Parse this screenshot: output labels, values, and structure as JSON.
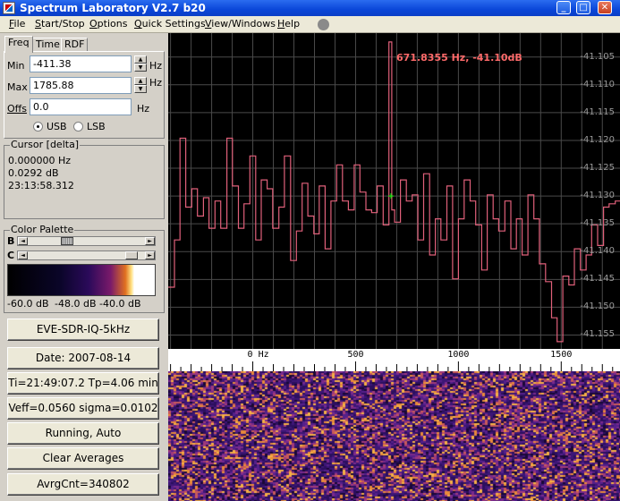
{
  "window": {
    "title": "Spectrum Laboratory V2.7 b20"
  },
  "menu": [
    "File",
    "Start/Stop",
    "Options",
    "Quick Settings",
    "View/Windows",
    "Help"
  ],
  "tabs": [
    "Freq",
    "Time",
    "RDF"
  ],
  "freq": {
    "min_label": "Min",
    "min_value": "-411.38",
    "max_label": "Max",
    "max_value": "1785.88",
    "offs_label": "Offs",
    "offs_value": "0.0",
    "unit": "Hz",
    "usb_label": "USB",
    "lsb_label": "LSB",
    "mode_selected": "USB"
  },
  "cursor": {
    "title": "Cursor [delta]",
    "freq": "0.000000 Hz",
    "db": "0.0292 dB",
    "time": "23:13:58.312"
  },
  "palette": {
    "title": "Color Palette",
    "b_label": "B",
    "c_label": "C",
    "b_level": 0.32,
    "c_level": 0.93,
    "scale_labels": [
      "-60.0 dB",
      "-48.0 dB",
      "-40.0 dB"
    ]
  },
  "buttons": {
    "source": "EVE-SDR-IQ-5kHz",
    "date": "Date: 2007-08-14",
    "time_info": "Ti=21:49:07.2  Tp=4.06 min",
    "veff": "Veff=0.0560 sigma=0.0102",
    "status": "Running, Auto",
    "clear": "Clear Averages",
    "avrg": "AvrgCnt=340802"
  },
  "spectrum": {
    "cursor_readout": "671.8355 Hz, -41.10dB",
    "colors": {
      "trace": "#e0607a",
      "grid": "#4a4a4a",
      "marker": "#00ff00",
      "readout": "#ff6a6a"
    }
  },
  "chart_data": {
    "type": "line",
    "xlabel": "",
    "ylabel": "",
    "xlim": [
      -411.38,
      1785.88
    ],
    "ylim": [
      -41.1575,
      -41.1007
    ],
    "x_ticks": [
      0,
      500,
      1000,
      1500
    ],
    "x_tick_labels": [
      "0 Hz",
      "500",
      "1000",
      "1500"
    ],
    "y_ticks": [
      -41.105,
      -41.11,
      -41.115,
      -41.12,
      -41.125,
      -41.13,
      -41.135,
      -41.14,
      -41.145,
      -41.15,
      -41.155
    ],
    "y_tick_labels": [
      "-41.105",
      "-41.110",
      "-41.115",
      "-41.120",
      "-41.125",
      "-41.130",
      "-41.135",
      "-41.140",
      "-41.145",
      "-41.150",
      "-41.155"
    ],
    "grid": true,
    "series": [
      {
        "values": [
          [
            -411,
            -41.1464
          ],
          [
            -381,
            -41.1464
          ],
          [
            -381,
            -41.1379
          ],
          [
            -354,
            -41.1379
          ],
          [
            -354,
            -41.1196
          ],
          [
            -326,
            -41.1196
          ],
          [
            -326,
            -41.132
          ],
          [
            -297,
            -41.132
          ],
          [
            -297,
            -41.1287
          ],
          [
            -269,
            -41.1287
          ],
          [
            -269,
            -41.1336
          ],
          [
            -240,
            -41.1336
          ],
          [
            -240,
            -41.1303
          ],
          [
            -213,
            -41.1303
          ],
          [
            -213,
            -41.1358
          ],
          [
            -184,
            -41.1358
          ],
          [
            -184,
            -41.1309
          ],
          [
            -156,
            -41.1309
          ],
          [
            -156,
            -41.1358
          ],
          [
            -126,
            -41.1358
          ],
          [
            -126,
            -41.1196
          ],
          [
            -99,
            -41.1196
          ],
          [
            -99,
            -41.1282
          ],
          [
            -70,
            -41.1282
          ],
          [
            -70,
            -41.1358
          ],
          [
            -43,
            -41.1358
          ],
          [
            -43,
            -41.1314
          ],
          [
            -14,
            -41.1314
          ],
          [
            -14,
            -41.1228
          ],
          [
            14,
            -41.1228
          ],
          [
            14,
            -41.1379
          ],
          [
            41,
            -41.1379
          ],
          [
            41,
            -41.1271
          ],
          [
            70,
            -41.1271
          ],
          [
            70,
            -41.1287
          ],
          [
            97,
            -41.1287
          ],
          [
            97,
            -41.1358
          ],
          [
            127,
            -41.1358
          ],
          [
            127,
            -41.132
          ],
          [
            154,
            -41.132
          ],
          [
            154,
            -41.1228
          ],
          [
            184,
            -41.1228
          ],
          [
            184,
            -41.1416
          ],
          [
            212,
            -41.1416
          ],
          [
            212,
            -41.1363
          ],
          [
            240,
            -41.1363
          ],
          [
            240,
            -41.1277
          ],
          [
            268,
            -41.1277
          ],
          [
            268,
            -41.1336
          ],
          [
            297,
            -41.1336
          ],
          [
            297,
            -41.1368
          ],
          [
            323,
            -41.1368
          ],
          [
            323,
            -41.1282
          ],
          [
            352,
            -41.1282
          ],
          [
            352,
            -41.1395
          ],
          [
            380,
            -41.1395
          ],
          [
            380,
            -41.1309
          ],
          [
            408,
            -41.1309
          ],
          [
            408,
            -41.1244
          ],
          [
            436,
            -41.1244
          ],
          [
            436,
            -41.1309
          ],
          [
            465,
            -41.1309
          ],
          [
            465,
            -41.1325
          ],
          [
            493,
            -41.1325
          ],
          [
            493,
            -41.1244
          ],
          [
            521,
            -41.1244
          ],
          [
            521,
            -41.1293
          ],
          [
            550,
            -41.1293
          ],
          [
            550,
            -41.1325
          ],
          [
            578,
            -41.1325
          ],
          [
            578,
            -41.133
          ],
          [
            605,
            -41.133
          ],
          [
            605,
            -41.1282
          ],
          [
            634,
            -41.1282
          ],
          [
            634,
            -41.1352
          ],
          [
            662,
            -41.1352
          ],
          [
            662,
            -41.1023
          ],
          [
            676,
            -41.1023
          ],
          [
            676,
            -41.1325
          ],
          [
            690,
            -41.1325
          ],
          [
            690,
            -41.1347
          ],
          [
            718,
            -41.1347
          ],
          [
            718,
            -41.1271
          ],
          [
            747,
            -41.1271
          ],
          [
            747,
            -41.1309
          ],
          [
            775,
            -41.1309
          ],
          [
            775,
            -41.1298
          ],
          [
            803,
            -41.1298
          ],
          [
            803,
            -41.1379
          ],
          [
            831,
            -41.1379
          ],
          [
            831,
            -41.126
          ],
          [
            860,
            -41.126
          ],
          [
            860,
            -41.1406
          ],
          [
            888,
            -41.1406
          ],
          [
            888,
            -41.1341
          ],
          [
            915,
            -41.1341
          ],
          [
            915,
            -41.1379
          ],
          [
            944,
            -41.1379
          ],
          [
            944,
            -41.1282
          ],
          [
            972,
            -41.1282
          ],
          [
            972,
            -41.1449
          ],
          [
            1000,
            -41.1449
          ],
          [
            1000,
            -41.1341
          ],
          [
            1028,
            -41.1341
          ],
          [
            1028,
            -41.1271
          ],
          [
            1057,
            -41.1271
          ],
          [
            1057,
            -41.1309
          ],
          [
            1084,
            -41.1309
          ],
          [
            1084,
            -41.1352
          ],
          [
            1113,
            -41.1352
          ],
          [
            1113,
            -41.1433
          ],
          [
            1140,
            -41.1433
          ],
          [
            1140,
            -41.1298
          ],
          [
            1169,
            -41.1298
          ],
          [
            1169,
            -41.1341
          ],
          [
            1196,
            -41.1341
          ],
          [
            1196,
            -41.1363
          ],
          [
            1226,
            -41.1363
          ],
          [
            1226,
            -41.1309
          ],
          [
            1255,
            -41.1309
          ],
          [
            1255,
            -41.1395
          ],
          [
            1282,
            -41.1395
          ],
          [
            1282,
            -41.1341
          ],
          [
            1310,
            -41.1341
          ],
          [
            1310,
            -41.1406
          ],
          [
            1338,
            -41.1406
          ],
          [
            1338,
            -41.1298
          ],
          [
            1367,
            -41.1298
          ],
          [
            1367,
            -41.1341
          ],
          [
            1394,
            -41.1341
          ],
          [
            1394,
            -41.1422
          ],
          [
            1424,
            -41.1422
          ],
          [
            1424,
            -41.1454
          ],
          [
            1453,
            -41.1454
          ],
          [
            1453,
            -41.1519
          ],
          [
            1480,
            -41.1519
          ],
          [
            1480,
            -41.1562
          ],
          [
            1508,
            -41.1562
          ],
          [
            1508,
            -41.1444
          ],
          [
            1537,
            -41.1444
          ],
          [
            1537,
            -41.146
          ],
          [
            1564,
            -41.146
          ],
          [
            1564,
            -41.1395
          ],
          [
            1593,
            -41.1395
          ],
          [
            1593,
            -41.1433
          ],
          [
            1621,
            -41.1433
          ],
          [
            1621,
            -41.1406
          ],
          [
            1648,
            -41.1406
          ],
          [
            1648,
            -41.1352
          ],
          [
            1677,
            -41.1352
          ],
          [
            1677,
            -41.1389
          ],
          [
            1706,
            -41.1389
          ],
          [
            1706,
            -41.132
          ],
          [
            1733,
            -41.132
          ],
          [
            1733,
            -41.1314
          ],
          [
            1763,
            -41.1314
          ],
          [
            1763,
            -41.1309
          ],
          [
            1786,
            -41.1309
          ]
        ]
      }
    ],
    "cursor_marker": [
      671.8,
      -41.13
    ]
  }
}
